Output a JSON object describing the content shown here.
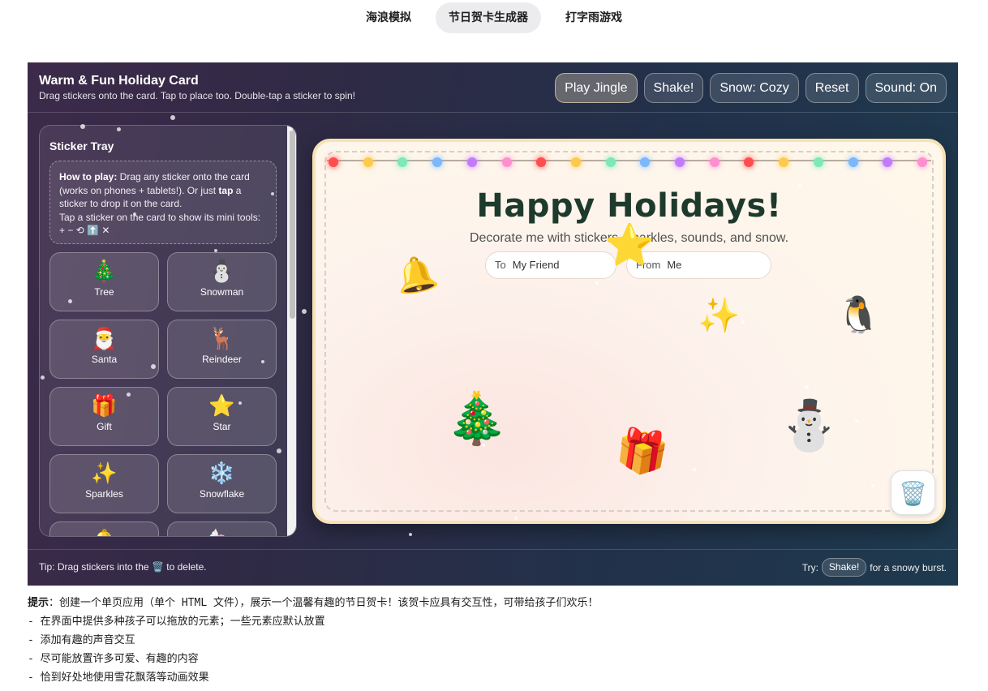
{
  "tabs": [
    {
      "label": "海浪模拟",
      "active": false
    },
    {
      "label": "节日贺卡生成器",
      "active": true
    },
    {
      "label": "打字雨游戏",
      "active": false
    }
  ],
  "header": {
    "title": "Warm & Fun Holiday Card",
    "subtitle": "Drag stickers onto the card. Tap to place too. Double-tap a sticker to spin!",
    "buttons": {
      "play_jingle": "Play Jingle",
      "shake": "Shake!",
      "snow": "Snow: Cozy",
      "reset": "Reset",
      "sound": "Sound: On"
    }
  },
  "tray": {
    "title": "Sticker Tray",
    "howto": {
      "lead": "How to play:",
      "part1": " Drag any sticker onto the card (works on phones + tablets!). Or just ",
      "tap": "tap",
      "part2": " a sticker to drop it on the card.",
      "line2": "Tap a sticker on the card to show its mini tools: + − ⟲ ⬆️ ✕"
    },
    "stickers": [
      {
        "emoji": "🎄",
        "label": "Tree"
      },
      {
        "emoji": "⛄",
        "label": "Snowman"
      },
      {
        "emoji": "🎅",
        "label": "Santa"
      },
      {
        "emoji": "🦌",
        "label": "Reindeer"
      },
      {
        "emoji": "🎁",
        "label": "Gift"
      },
      {
        "emoji": "⭐",
        "label": "Star"
      },
      {
        "emoji": "✨",
        "label": "Sparkles"
      },
      {
        "emoji": "❄️",
        "label": "Snowflake"
      },
      {
        "emoji": "🔔",
        "label": ""
      },
      {
        "emoji": "🍬",
        "label": ""
      }
    ]
  },
  "card": {
    "title": "Happy Holidays!",
    "subtitle": "Decorate me with stickers, sparkles, sounds, and snow.",
    "to_label": "To",
    "to_value": "My Friend",
    "from_label": "From",
    "from_value": "Me",
    "placed_stickers": [
      "🔔",
      "⭐",
      "✨",
      "🐧",
      "🎄",
      "🎁",
      "⛄"
    ],
    "trash_icon": "🗑️",
    "light_colors": [
      "#ff4d4d",
      "#ffc94d",
      "#7de8b8",
      "#7ab8ff",
      "#c27bff",
      "#ff8fd0"
    ]
  },
  "footer": {
    "tip_before": "Tip: Drag stickers into the",
    "tip_icon": "🗑️",
    "tip_after": "to delete.",
    "try_label": "Try:",
    "try_button": "Shake!",
    "try_after": "for a snowy burst."
  },
  "prompt": {
    "lead": "提示",
    "intro": "：创建一个单页应用（单个 HTML 文件），展示一个温馨有趣的节日贺卡！该贺卡应具有交互性，可带给孩子们欢乐！",
    "items": [
      "- 在界面中提供多种孩子可以拖放的元素；一些元素应默认放置",
      "- 添加有趣的声音交互",
      "- 尽可能放置许多可爱、有趣的内容",
      "- 恰到好处地使用雪花飘落等动画效果"
    ]
  }
}
